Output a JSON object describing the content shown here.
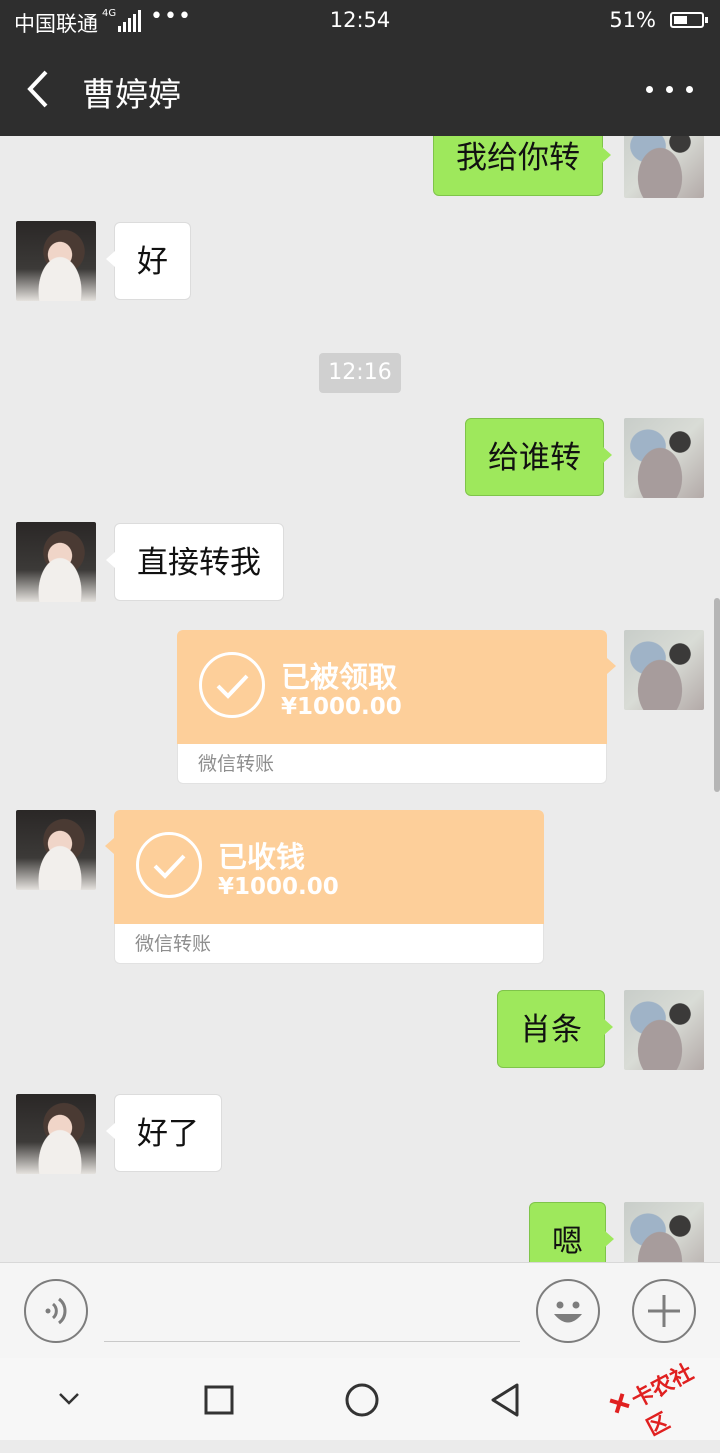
{
  "status_bar": {
    "carrier": "中国联通",
    "network": "4G",
    "time": "12:54",
    "battery_text": "51%",
    "battery_level": 0.51
  },
  "header": {
    "title": "曹婷婷",
    "back_icon": "chevron-left-icon",
    "menu_icon": "more-dots-icon"
  },
  "messages": [
    {
      "side": "out",
      "text": "我给你转"
    },
    {
      "side": "in",
      "text": "好"
    },
    {
      "type": "time",
      "text": "12:16"
    },
    {
      "side": "out",
      "text": "给谁转"
    },
    {
      "side": "in",
      "text": "直接转我"
    },
    {
      "side": "out",
      "type": "transfer",
      "status": "已被领取",
      "amount": "¥1000.00",
      "label": "微信转账"
    },
    {
      "side": "in",
      "type": "transfer",
      "status": "已收钱",
      "amount": "¥1000.00",
      "label": "微信转账"
    },
    {
      "side": "out",
      "text": "肖条"
    },
    {
      "side": "in",
      "text": "好了"
    },
    {
      "side": "out",
      "text": "嗯"
    }
  ],
  "input_bar": {
    "voice_icon": "voice-icon",
    "emoji_icon": "emoji-icon",
    "plus_icon": "plus-icon"
  },
  "nav_bar": {
    "icons": [
      "chevron-down-icon",
      "square-icon",
      "circle-icon",
      "triangle-back-icon"
    ]
  },
  "watermark": {
    "text": "卡农社区"
  },
  "colors": {
    "header_bg": "#2e2e2e",
    "chat_bg": "#ebebeb",
    "outgoing_bubble": "#9ee85c",
    "incoming_bubble": "#ffffff",
    "transfer_bg": "#fdcf9a"
  }
}
